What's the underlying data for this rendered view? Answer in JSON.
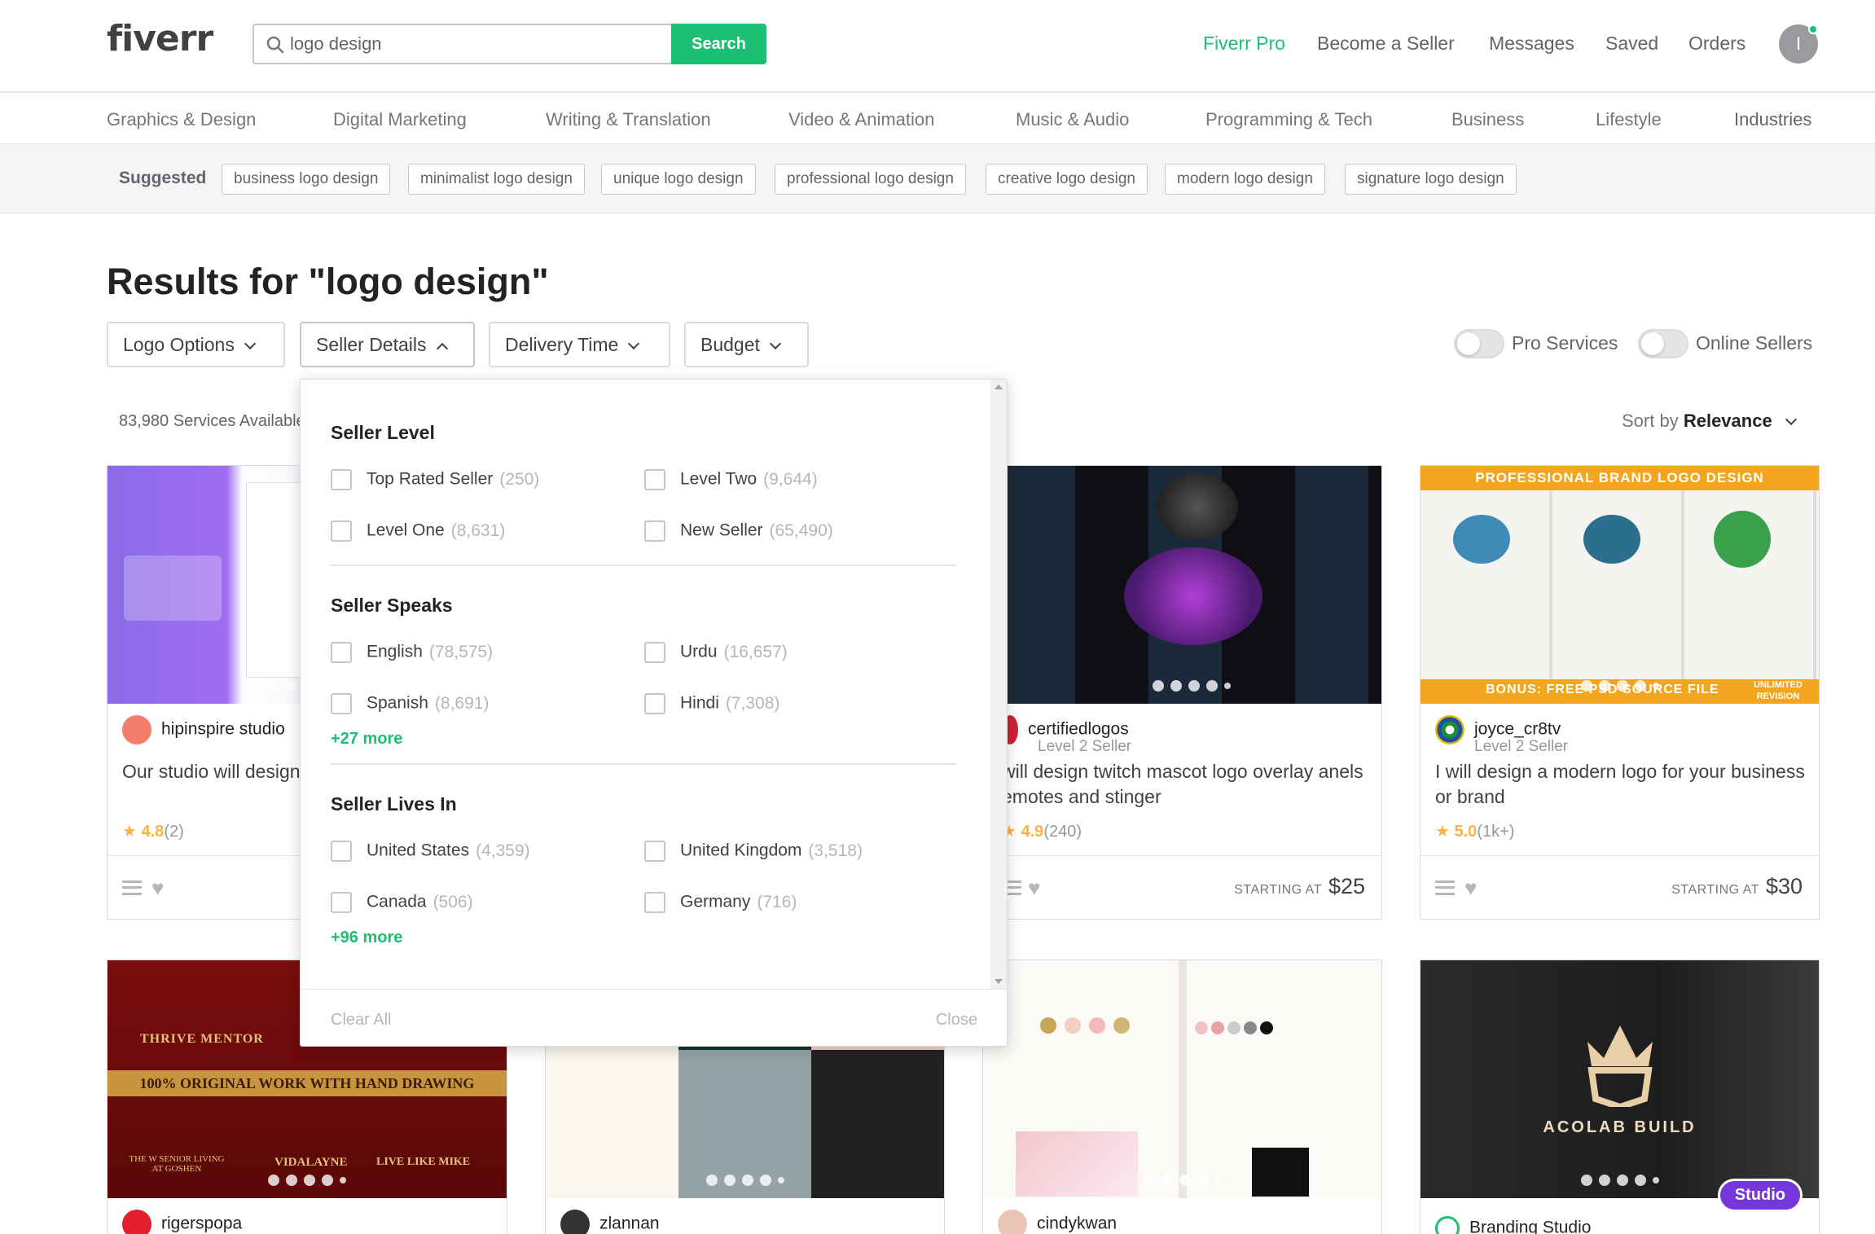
{
  "header": {
    "logo": "fiverr",
    "search_value": "logo design",
    "search_button": "Search",
    "nav": [
      "Fiverr Pro",
      "Become a Seller",
      "Messages",
      "Saved",
      "Orders"
    ],
    "avatar_initial": "I"
  },
  "categories": [
    "Graphics & Design",
    "Digital Marketing",
    "Writing & Translation",
    "Video & Animation",
    "Music & Audio",
    "Programming & Tech",
    "Business",
    "Lifestyle",
    "Industries"
  ],
  "suggested": {
    "label": "Suggested",
    "chips": [
      "business logo design",
      "minimalist logo design",
      "unique logo design",
      "professional logo design",
      "creative logo design",
      "modern logo design",
      "signature logo design"
    ]
  },
  "results_title": "Results for \"logo design\"",
  "filters": [
    "Logo Options",
    "Seller Details",
    "Delivery Time",
    "Budget"
  ],
  "toggles": [
    "Pro Services",
    "Online Sellers"
  ],
  "services_count": "83,980 Services Available",
  "sort": {
    "label": "Sort by",
    "value": "Relevance"
  },
  "dropdown": {
    "seller_level": {
      "title": "Seller Level",
      "options": [
        {
          "label": "Top Rated Seller",
          "count": "(250)"
        },
        {
          "label": "Level Two",
          "count": "(9,644)"
        },
        {
          "label": "Level One",
          "count": "(8,631)"
        },
        {
          "label": "New Seller",
          "count": "(65,490)"
        }
      ]
    },
    "seller_speaks": {
      "title": "Seller Speaks",
      "options": [
        {
          "label": "English",
          "count": "(78,575)"
        },
        {
          "label": "Urdu",
          "count": "(16,657)"
        },
        {
          "label": "Spanish",
          "count": "(8,691)"
        },
        {
          "label": "Hindi",
          "count": "(7,308)"
        }
      ],
      "more": "+27 more"
    },
    "seller_lives": {
      "title": "Seller Lives In",
      "options": [
        {
          "label": "United States",
          "count": "(4,359)"
        },
        {
          "label": "United Kingdom",
          "count": "(3,518)"
        },
        {
          "label": "Canada",
          "count": "(506)"
        },
        {
          "label": "Germany",
          "count": "(716)"
        }
      ],
      "more": "+96 more"
    },
    "clear": "Clear All",
    "close": "Close"
  },
  "cards": [
    {
      "seller": "hipinspire studio",
      "level": "",
      "title": "Our studio will design website and logo",
      "rating": "4.8",
      "rating_count": "(2)",
      "starting_at": "",
      "price": ""
    },
    {
      "seller": "certifiedlogos",
      "level": "Level 2 Seller",
      "title": "will design twitch mascot logo overlay anels emotes and stinger",
      "rating": "4.9",
      "rating_count": "(240)",
      "starting_at": "STARTING AT",
      "price": "$25"
    },
    {
      "seller": "joyce_cr8tv",
      "level": "Level 2 Seller",
      "title": "I will design a modern logo for your business or brand",
      "rating": "5.0",
      "rating_count": "(1k+)",
      "starting_at": "STARTING AT",
      "price": "$30"
    },
    {
      "seller": "rigerspopa"
    },
    {
      "seller": "zlannan"
    },
    {
      "seller": "cindykwan"
    },
    {
      "seller": "Branding Studio",
      "badge": "Studio"
    }
  ],
  "card_image_text": {
    "card3_banner": "PROFESSIONAL BRAND LOGO DESIGN",
    "card3_bonus": "BONUS: FREE PSD SOURCE FILE",
    "card3_unlimited": "UNLIMITED REVISION",
    "card4_top": "THRIVE MENTOR",
    "card4_banner": "100% ORIGINAL WORK WITH HAND DRAWING",
    "card4_names": [
      "THE W SENIOR LIVING AT GOSHEN",
      "VIDALAYNE",
      "LIVE LIKE MIKE"
    ],
    "card7_brand": "ACOLAB BUILD"
  },
  "colors": {
    "brand": "#1dbf73",
    "star": "#ffb33e",
    "studio": "#7537d8"
  }
}
